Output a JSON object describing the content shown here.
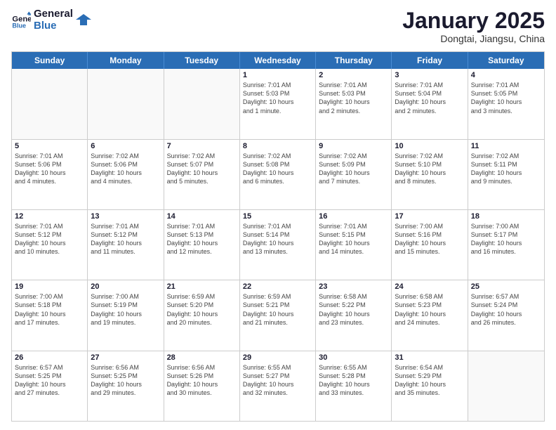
{
  "header": {
    "logo_line1": "General",
    "logo_line2": "Blue",
    "month": "January 2025",
    "location": "Dongtai, Jiangsu, China"
  },
  "days_of_week": [
    "Sunday",
    "Monday",
    "Tuesday",
    "Wednesday",
    "Thursday",
    "Friday",
    "Saturday"
  ],
  "weeks": [
    [
      {
        "num": "",
        "info": ""
      },
      {
        "num": "",
        "info": ""
      },
      {
        "num": "",
        "info": ""
      },
      {
        "num": "1",
        "info": "Sunrise: 7:01 AM\nSunset: 5:03 PM\nDaylight: 10 hours\nand 1 minute."
      },
      {
        "num": "2",
        "info": "Sunrise: 7:01 AM\nSunset: 5:03 PM\nDaylight: 10 hours\nand 2 minutes."
      },
      {
        "num": "3",
        "info": "Sunrise: 7:01 AM\nSunset: 5:04 PM\nDaylight: 10 hours\nand 2 minutes."
      },
      {
        "num": "4",
        "info": "Sunrise: 7:01 AM\nSunset: 5:05 PM\nDaylight: 10 hours\nand 3 minutes."
      }
    ],
    [
      {
        "num": "5",
        "info": "Sunrise: 7:01 AM\nSunset: 5:06 PM\nDaylight: 10 hours\nand 4 minutes."
      },
      {
        "num": "6",
        "info": "Sunrise: 7:02 AM\nSunset: 5:06 PM\nDaylight: 10 hours\nand 4 minutes."
      },
      {
        "num": "7",
        "info": "Sunrise: 7:02 AM\nSunset: 5:07 PM\nDaylight: 10 hours\nand 5 minutes."
      },
      {
        "num": "8",
        "info": "Sunrise: 7:02 AM\nSunset: 5:08 PM\nDaylight: 10 hours\nand 6 minutes."
      },
      {
        "num": "9",
        "info": "Sunrise: 7:02 AM\nSunset: 5:09 PM\nDaylight: 10 hours\nand 7 minutes."
      },
      {
        "num": "10",
        "info": "Sunrise: 7:02 AM\nSunset: 5:10 PM\nDaylight: 10 hours\nand 8 minutes."
      },
      {
        "num": "11",
        "info": "Sunrise: 7:02 AM\nSunset: 5:11 PM\nDaylight: 10 hours\nand 9 minutes."
      }
    ],
    [
      {
        "num": "12",
        "info": "Sunrise: 7:01 AM\nSunset: 5:12 PM\nDaylight: 10 hours\nand 10 minutes."
      },
      {
        "num": "13",
        "info": "Sunrise: 7:01 AM\nSunset: 5:12 PM\nDaylight: 10 hours\nand 11 minutes."
      },
      {
        "num": "14",
        "info": "Sunrise: 7:01 AM\nSunset: 5:13 PM\nDaylight: 10 hours\nand 12 minutes."
      },
      {
        "num": "15",
        "info": "Sunrise: 7:01 AM\nSunset: 5:14 PM\nDaylight: 10 hours\nand 13 minutes."
      },
      {
        "num": "16",
        "info": "Sunrise: 7:01 AM\nSunset: 5:15 PM\nDaylight: 10 hours\nand 14 minutes."
      },
      {
        "num": "17",
        "info": "Sunrise: 7:00 AM\nSunset: 5:16 PM\nDaylight: 10 hours\nand 15 minutes."
      },
      {
        "num": "18",
        "info": "Sunrise: 7:00 AM\nSunset: 5:17 PM\nDaylight: 10 hours\nand 16 minutes."
      }
    ],
    [
      {
        "num": "19",
        "info": "Sunrise: 7:00 AM\nSunset: 5:18 PM\nDaylight: 10 hours\nand 17 minutes."
      },
      {
        "num": "20",
        "info": "Sunrise: 7:00 AM\nSunset: 5:19 PM\nDaylight: 10 hours\nand 19 minutes."
      },
      {
        "num": "21",
        "info": "Sunrise: 6:59 AM\nSunset: 5:20 PM\nDaylight: 10 hours\nand 20 minutes."
      },
      {
        "num": "22",
        "info": "Sunrise: 6:59 AM\nSunset: 5:21 PM\nDaylight: 10 hours\nand 21 minutes."
      },
      {
        "num": "23",
        "info": "Sunrise: 6:58 AM\nSunset: 5:22 PM\nDaylight: 10 hours\nand 23 minutes."
      },
      {
        "num": "24",
        "info": "Sunrise: 6:58 AM\nSunset: 5:23 PM\nDaylight: 10 hours\nand 24 minutes."
      },
      {
        "num": "25",
        "info": "Sunrise: 6:57 AM\nSunset: 5:24 PM\nDaylight: 10 hours\nand 26 minutes."
      }
    ],
    [
      {
        "num": "26",
        "info": "Sunrise: 6:57 AM\nSunset: 5:25 PM\nDaylight: 10 hours\nand 27 minutes."
      },
      {
        "num": "27",
        "info": "Sunrise: 6:56 AM\nSunset: 5:25 PM\nDaylight: 10 hours\nand 29 minutes."
      },
      {
        "num": "28",
        "info": "Sunrise: 6:56 AM\nSunset: 5:26 PM\nDaylight: 10 hours\nand 30 minutes."
      },
      {
        "num": "29",
        "info": "Sunrise: 6:55 AM\nSunset: 5:27 PM\nDaylight: 10 hours\nand 32 minutes."
      },
      {
        "num": "30",
        "info": "Sunrise: 6:55 AM\nSunset: 5:28 PM\nDaylight: 10 hours\nand 33 minutes."
      },
      {
        "num": "31",
        "info": "Sunrise: 6:54 AM\nSunset: 5:29 PM\nDaylight: 10 hours\nand 35 minutes."
      },
      {
        "num": "",
        "info": ""
      }
    ]
  ]
}
